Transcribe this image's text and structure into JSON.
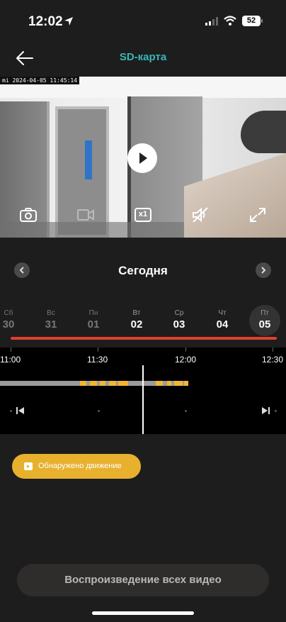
{
  "status_bar": {
    "time": "12:02",
    "battery": "52"
  },
  "header": {
    "title": "SD-карта"
  },
  "video": {
    "timestamp": "2024-04-05 11:45:14",
    "zoom_label": "x1"
  },
  "day_nav": {
    "title": "Сегодня"
  },
  "week": [
    {
      "weekday": "Сб",
      "day": "30",
      "state": "past"
    },
    {
      "weekday": "Вс",
      "day": "31",
      "state": "past"
    },
    {
      "weekday": "Пн",
      "day": "01",
      "state": "past"
    },
    {
      "weekday": "Вт",
      "day": "02",
      "state": "current"
    },
    {
      "weekday": "Ср",
      "day": "03",
      "state": "current"
    },
    {
      "weekday": "Чт",
      "day": "04",
      "state": "current"
    },
    {
      "weekday": "Пт",
      "day": "05",
      "state": "selected"
    }
  ],
  "timeline": {
    "labels": [
      "11:00",
      "11:30",
      "12:00",
      "12:30"
    ]
  },
  "event_chip": {
    "label": "Обнаружено движение"
  },
  "bottom": {
    "play_all": "Воспроизведение всех видео"
  },
  "colors": {
    "accent": "#3ab6b8",
    "motion": "#e7b12e",
    "red_line": "#e0402c"
  }
}
